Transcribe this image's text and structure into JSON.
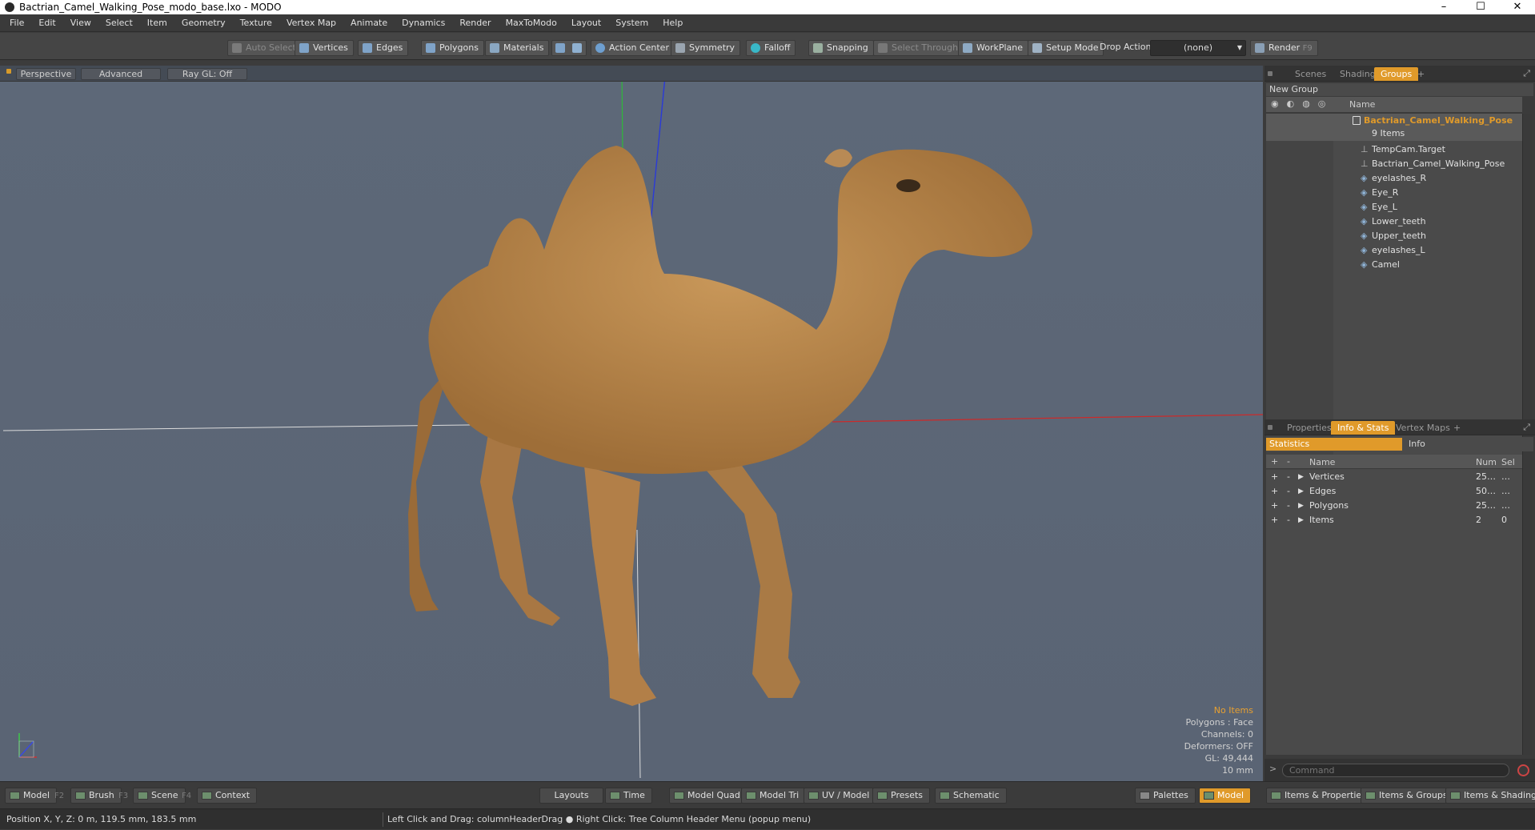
{
  "window": {
    "title": "Bactrian_Camel_Walking_Pose_modo_base.lxo - MODO",
    "minimize": "–",
    "maximize": "☐",
    "close": "✕"
  },
  "menu": [
    "File",
    "Edit",
    "View",
    "Select",
    "Item",
    "Geometry",
    "Texture",
    "Vertex Map",
    "Animate",
    "Dynamics",
    "Render",
    "MaxToModo",
    "Layout",
    "System",
    "Help"
  ],
  "toolbar": {
    "auto_select": "Auto Select",
    "vertices": "Vertices",
    "edges": "Edges",
    "polygons": "Polygons",
    "materials": "Materials",
    "action_center": "Action Center",
    "symmetry": "Symmetry",
    "falloff": "Falloff",
    "snapping": "Snapping",
    "select_through": "Select Through",
    "workplane": "WorkPlane",
    "setup_mode": "Setup Mode",
    "drop_action_label": "Drop Action",
    "drop_action_value": "(none)",
    "render": "Render",
    "render_key": "F9"
  },
  "viewport": {
    "view_mode": "Perspective",
    "shading": "Advanced",
    "raygl": "Ray GL: Off",
    "stats": {
      "selection": "No Items",
      "polygons": "Polygons : Face",
      "channels": "Channels: 0",
      "deformers": "Deformers: OFF",
      "gl": "GL: 49,444",
      "scale": "10 mm"
    }
  },
  "groups_panel": {
    "tabs": [
      "Scenes",
      "Shading",
      "Groups"
    ],
    "add_tab": "+",
    "new_group": "New Group",
    "col_name": "Name",
    "group": {
      "name": "Bactrian_Camel_Walking_Pose",
      "count": "9 Items",
      "items": [
        "TempCam.Target",
        "Bactrian_Camel_Walking_Pose",
        "eyelashes_R",
        "Eye_R",
        "Eye_L",
        "Lower_teeth",
        "Upper_teeth",
        "eyelashes_L",
        "Camel"
      ]
    }
  },
  "info_panel": {
    "tabs": [
      "Properties",
      "Info & Stats",
      "Vertex Maps"
    ],
    "add_tab": "+",
    "subtabs": [
      "Statistics",
      "Info"
    ],
    "columns": {
      "name": "Name",
      "num": "Num",
      "sel": "Sel"
    },
    "rows": [
      {
        "name": "Vertices",
        "num": "25…",
        "sel": "…"
      },
      {
        "name": "Edges",
        "num": "50…",
        "sel": "…"
      },
      {
        "name": "Polygons",
        "num": "25…",
        "sel": "…"
      },
      {
        "name": "Items",
        "num": "2",
        "sel": "0"
      }
    ],
    "command_placeholder": "Command"
  },
  "bottombar": {
    "left": [
      {
        "label": "Model",
        "key": "F2"
      },
      {
        "label": "Brush",
        "key": "F3"
      },
      {
        "label": "Scene",
        "key": "F4"
      },
      {
        "label": "Context",
        "key": ""
      }
    ],
    "center": [
      "Layouts",
      "Time",
      "Model Quad",
      "Model Tri",
      "UV / Model",
      "Presets",
      "Schematic"
    ],
    "right": [
      "Palettes",
      "Model",
      "Items & Properties",
      "Items & Groups",
      "Items & Shading"
    ]
  },
  "statusbar": {
    "position": "Position X, Y, Z:   0 m, 119.5 mm, 183.5 mm",
    "hint": "Left Click and Drag: columnHeaderDrag ● Right Click: Tree Column Header Menu (popup menu)"
  },
  "colors": {
    "accent": "#e09a2a",
    "viewport": "#5b6575",
    "axis_x": "#cc2a2a",
    "axis_y": "#2fb83a",
    "axis_z": "#2a3ad8"
  }
}
